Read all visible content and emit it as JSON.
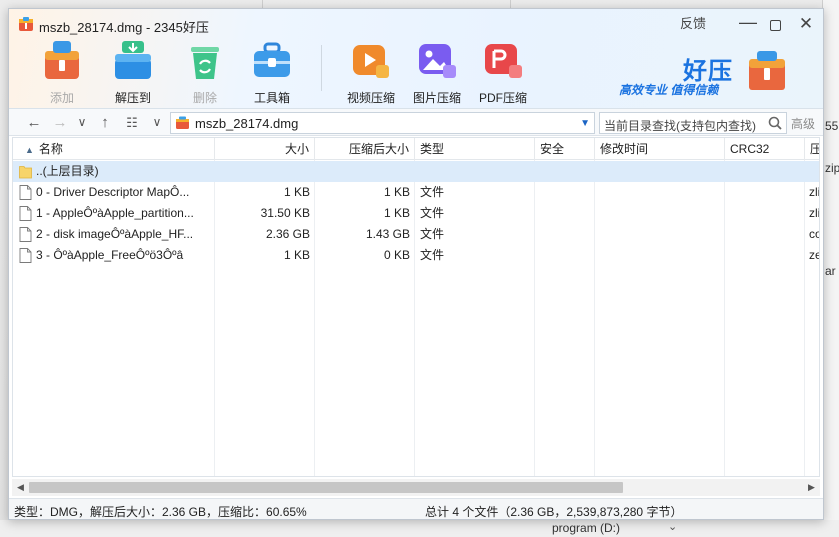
{
  "window": {
    "title": "mszb_28174.dmg - 2345好压",
    "feedback": "反馈",
    "minimize": "—",
    "close": "✕"
  },
  "toolbar": {
    "items": [
      {
        "label": "添加",
        "icon": "add-archive-icon",
        "enabled": false
      },
      {
        "label": "解压到",
        "icon": "extract-icon",
        "enabled": true
      },
      {
        "label": "删除",
        "icon": "recycle-delete-icon",
        "enabled": false
      },
      {
        "label": "工具箱",
        "icon": "toolbox-icon",
        "enabled": true
      },
      {
        "label": "视频压缩",
        "icon": "video-compress-icon",
        "enabled": true
      },
      {
        "label": "图片压缩",
        "icon": "image-compress-icon",
        "enabled": true
      },
      {
        "label": "PDF压缩",
        "icon": "pdf-compress-icon",
        "enabled": true
      }
    ]
  },
  "brand": {
    "name": "好压",
    "slogan": "高效专业  值得信赖"
  },
  "address": {
    "path": "mszb_28174.dmg",
    "search_placeholder": "当前目录查找(支持包内查找)",
    "advanced": "高级"
  },
  "list": {
    "columns": [
      "名称",
      "大小",
      "压缩后大小",
      "类型",
      "安全",
      "修改时间",
      "CRC32",
      "压缩"
    ],
    "rows": [
      {
        "name": "..(上层目录)",
        "size": "",
        "packed": "",
        "type": "",
        "method": "",
        "kind": "folder"
      },
      {
        "name": "0 - Driver Descriptor MapÔ...",
        "size": "1 KB",
        "packed": "1 KB",
        "type": "文件",
        "method": "zli",
        "kind": "file"
      },
      {
        "name": "1 - AppleÔºàApple_partition...",
        "size": "31.50 KB",
        "packed": "1 KB",
        "type": "文件",
        "method": "zli",
        "kind": "file"
      },
      {
        "name": "2 - disk imageÔºàApple_HF...",
        "size": "2.36 GB",
        "packed": "1.43 GB",
        "type": "文件",
        "method": "cop",
        "kind": "file"
      },
      {
        "name": "3 - ÔºàApple_FreeÔºö3Ôºâ",
        "size": "1 KB",
        "packed": "0 KB",
        "type": "文件",
        "method": "ze",
        "kind": "file"
      }
    ]
  },
  "status": {
    "left": "类型：DMG，解压后大小：2.36 GB，压缩比：60.65%",
    "right": "总计 4 个文件（2.36 GB，2,539,873,280 字节）"
  },
  "background": {
    "right_labels": [
      "55",
      "zip",
      "ar"
    ],
    "drive_label": "program (D:)"
  },
  "colors": {
    "accent": "#1b73e0",
    "selection": "#dcebfa"
  }
}
